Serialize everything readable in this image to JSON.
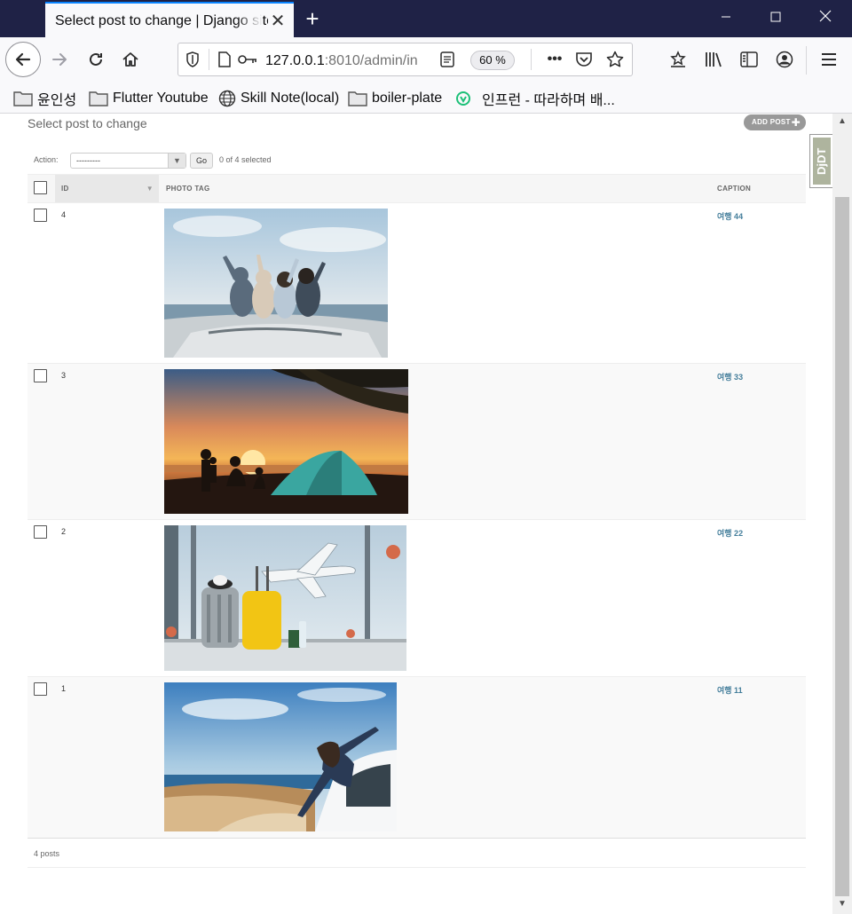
{
  "browser": {
    "tab_title": "Select post to change | Django site admin",
    "url_main": "127.0.0.1",
    "url_dim": ":8010/admin/in",
    "zoom": "60 %"
  },
  "bookmarks": [
    {
      "label": "윤인성",
      "icon": "folder-icon"
    },
    {
      "label": "Flutter Youtube",
      "icon": "folder-icon"
    },
    {
      "label": "Skill Note(local)",
      "icon": "globe-icon"
    },
    {
      "label": "boiler-plate",
      "icon": "folder-icon"
    },
    {
      "label": "인프런 - 따라하며 배...",
      "icon": "inflearn-icon"
    }
  ],
  "page": {
    "heading": "Select post to change",
    "add_button": "ADD POST",
    "action_label": "Action:",
    "action_value": "---------",
    "go_label": "Go",
    "selection_count": "0 of 4 selected",
    "djdt": "DjDT",
    "columns": {
      "id": "ID",
      "photo": "PHOTO TAG",
      "caption": "CAPTION"
    },
    "paginator": "4 posts"
  },
  "rows": [
    {
      "id": "4",
      "caption": "여행 44"
    },
    {
      "id": "3",
      "caption": "여행 33"
    },
    {
      "id": "2",
      "caption": "여행 22"
    },
    {
      "id": "1",
      "caption": "여행 11"
    }
  ],
  "colors": {
    "titlebar": "#1f2246",
    "link": "#447e9b",
    "accent": "#0a84ff"
  }
}
